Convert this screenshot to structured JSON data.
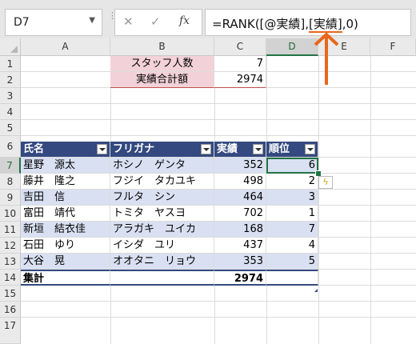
{
  "name_box": {
    "value": "D7",
    "dropdown_icon": "chevron-down-icon"
  },
  "formula_bar": {
    "cancel_icon": "close-icon",
    "enter_icon": "check-icon",
    "fx_label": "fx",
    "formula_before": "=RANK([@実績],",
    "formula_highlight": "[実績]",
    "formula_after": ",0)"
  },
  "columns": [
    "A",
    "B",
    "C",
    "D",
    "E",
    "F"
  ],
  "rows": [
    "1",
    "2",
    "3",
    "4",
    "5",
    "6",
    "7",
    "8",
    "9",
    "10",
    "11",
    "12",
    "13",
    "14",
    "15",
    "16",
    "17"
  ],
  "summary": {
    "staff_label": "スタッフ人数",
    "staff_value": "7",
    "total_label": "実績合計額",
    "total_value": "2974"
  },
  "table": {
    "headers": [
      "氏名",
      "フリガナ",
      "実績",
      "順位"
    ],
    "rows": [
      [
        "星野　源太",
        "ホシノ　ゲンタ",
        "352",
        "6"
      ],
      [
        "藤井　隆之",
        "フジイ　タカユキ",
        "498",
        "2"
      ],
      [
        "吉田　信",
        "フルタ　シン",
        "464",
        "3"
      ],
      [
        "富田　靖代",
        "トミタ　ヤスヨ",
        "702",
        "1"
      ],
      [
        "新垣　結衣佳",
        "アラガキ　ユイカ",
        "168",
        "7"
      ],
      [
        "石田　ゆり",
        "イシダ　ユリ",
        "437",
        "4"
      ],
      [
        "大谷　晃",
        "オオタニ　リョウ",
        "353",
        "5"
      ]
    ],
    "total_label": "集計",
    "total_value": "2974"
  },
  "colors": {
    "accent": "#e8671a",
    "table_header": "#33497f",
    "band": "#d9e0f2",
    "pink": "#f2d2d8",
    "select": "#217346"
  }
}
